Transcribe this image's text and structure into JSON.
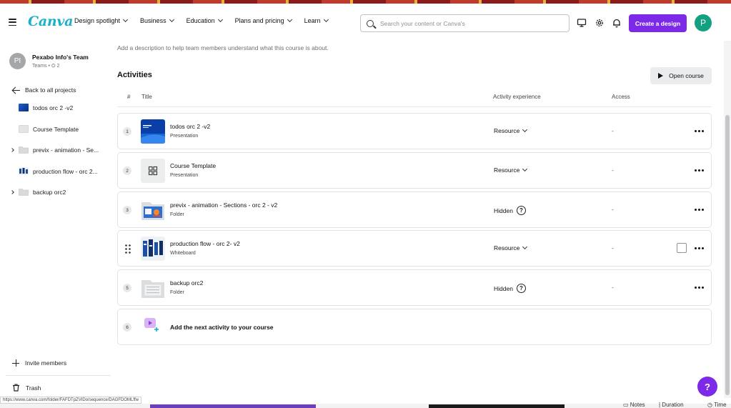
{
  "header": {
    "logo": "Canva",
    "nav": [
      "Design spotlight",
      "Business",
      "Education",
      "Plans and pricing",
      "Learn"
    ],
    "search_placeholder": "Search your content or Canva's",
    "create_button": "Create a design",
    "avatar_initial": "P",
    "colors": {
      "brand": "#7d2ae8",
      "logo": "#1ab0c9",
      "avatar": "#12a180"
    }
  },
  "sidebar": {
    "team_initials": "PI",
    "team_name": "Pexabo Info's Team",
    "team_meta": "Teams • ⛭ 2",
    "back_label": "Back to all projects",
    "items": [
      {
        "label": "todos orc 2 -v2",
        "kind": "presentation",
        "expandable": false
      },
      {
        "label": "Course Template",
        "kind": "template",
        "expandable": false
      },
      {
        "label": "previx - animation - Se...",
        "kind": "folder",
        "expandable": true
      },
      {
        "label": "production flow - orc 2...",
        "kind": "whiteboard",
        "expandable": false
      },
      {
        "label": "backup orc2",
        "kind": "folder",
        "expandable": true
      }
    ],
    "invite_label": "Invite members",
    "trash_label": "Trash"
  },
  "main": {
    "description_placeholder": "Add a description to help team members understand what this course is about.",
    "section_title": "Activities",
    "open_course_label": "Open course",
    "columns": {
      "num": "#",
      "title": "Title",
      "experience": "Activity experience",
      "access": "Access"
    },
    "rows": [
      {
        "num": "1",
        "title": "todos orc 2 -v2",
        "type": "Presentation",
        "experience": "Resource",
        "has_dropdown": true,
        "access": "-"
      },
      {
        "num": "2",
        "title": "Course Template",
        "type": "Presentation",
        "experience": "Resource",
        "has_dropdown": true,
        "access": "-"
      },
      {
        "num": "3",
        "title": "previx - animation - Sections - orc 2 - v2",
        "type": "Folder",
        "experience": "Hidden",
        "has_dropdown": false,
        "access": "-"
      },
      {
        "num": "4",
        "title": "production flow - orc 2- v2",
        "type": "Whiteboard",
        "experience": "Resource",
        "has_dropdown": true,
        "access": "-"
      },
      {
        "num": "5",
        "title": "backup orc2",
        "type": "Folder",
        "experience": "Hidden",
        "has_dropdown": false,
        "access": "-"
      }
    ],
    "add_row": {
      "num": "6",
      "label": "Add the next activity to your course"
    }
  },
  "help_fab": "?",
  "status_url": "https://www.canva.com/folder/FAFDTpZVIDo/sequence/DAGFDOMLffw",
  "taskbar": {
    "notes": "Notes",
    "duration": "| Duration",
    "time": "Time"
  }
}
